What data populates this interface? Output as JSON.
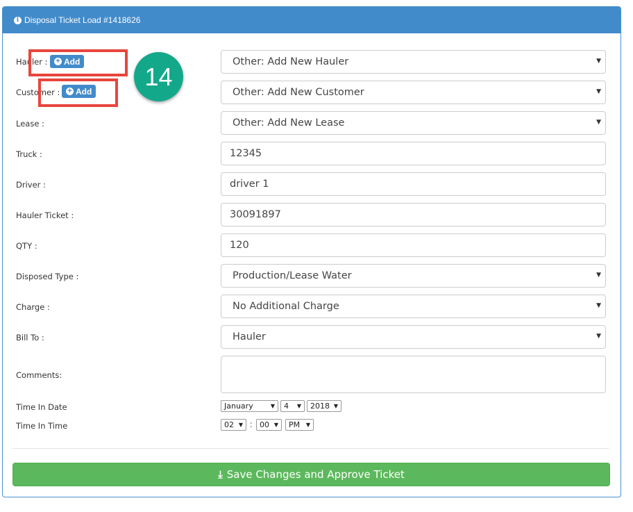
{
  "panel": {
    "title": "Disposal Ticket Load #1418626",
    "info_icon": "info-circle-icon"
  },
  "fields": {
    "hauler": {
      "label": "Hauler :",
      "add_label": "Add",
      "value": "Other: Add New Hauler"
    },
    "customer": {
      "label": "Customer :",
      "add_label": "Add",
      "value": "Other: Add New Customer"
    },
    "lease": {
      "label": "Lease :",
      "value": "Other: Add New Lease"
    },
    "truck": {
      "label": "Truck :",
      "value": "12345"
    },
    "driver": {
      "label": "Driver :",
      "value": "driver 1"
    },
    "hauler_ticket": {
      "label": "Hauler Ticket :",
      "value": "30091897"
    },
    "qty": {
      "label": "QTY :",
      "value": "120"
    },
    "disposed_type": {
      "label": "Disposed Type :",
      "value": "Production/Lease Water"
    },
    "charge": {
      "label": "Charge :",
      "value": "No Additional Charge"
    },
    "bill_to": {
      "label": "Bill To :",
      "value": "Hauler"
    },
    "comments": {
      "label": "Comments:",
      "value": ""
    }
  },
  "time_in_date": {
    "label": "Time In Date",
    "month": "January",
    "day": "4",
    "year": "2018"
  },
  "time_in_time": {
    "label": "Time In Time",
    "hour": "02",
    "separator": ":",
    "minute": "00",
    "ampm": "PM"
  },
  "annotation": {
    "step_number": "14",
    "highlight_color": "#e8453c",
    "badge_color": "#14a88a"
  },
  "actions": {
    "save_label": "Save Changes and Approve Ticket",
    "save_icon": "download-icon"
  },
  "colors": {
    "header": "#428bca",
    "save": "#5cb85c"
  }
}
